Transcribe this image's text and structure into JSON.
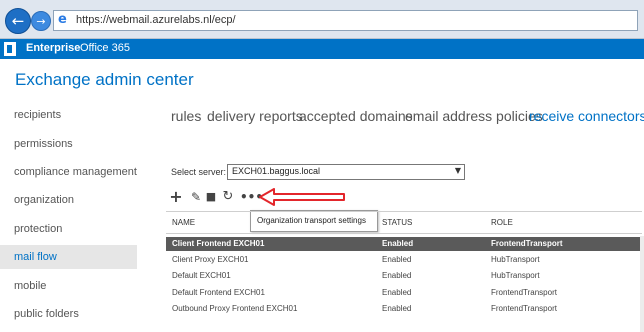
{
  "browser": {
    "url": "https://webmail.azurelabs.nl/ecp/",
    "back_icon": "back-arrow-icon",
    "forward_icon": "forward-arrow-icon"
  },
  "office_header": {
    "tabs": [
      "Enterprise",
      "Office 365"
    ],
    "logo_icon": "office-logo-icon"
  },
  "app": {
    "title": "Exchange admin center"
  },
  "sidebar": {
    "items": [
      {
        "label": "recipients"
      },
      {
        "label": "permissions"
      },
      {
        "label": "compliance management"
      },
      {
        "label": "organization"
      },
      {
        "label": "protection"
      },
      {
        "label": "mail flow",
        "selected": true
      },
      {
        "label": "mobile"
      },
      {
        "label": "public folders"
      }
    ]
  },
  "tabs": [
    {
      "label": "rules"
    },
    {
      "label": "delivery reports"
    },
    {
      "label": "accepted domains"
    },
    {
      "label": "email address policies"
    },
    {
      "label": "receive connectors",
      "active": true
    }
  ],
  "server": {
    "label": "Select server:",
    "value": "EXCH01.baggus.local"
  },
  "toolbar": {
    "icons": [
      "add-icon",
      "edit-icon",
      "delete-icon",
      "refresh-icon",
      "more-icon"
    ],
    "tooltip": "Organization transport settings"
  },
  "table": {
    "columns": [
      "NAME",
      "STATUS",
      "ROLE"
    ],
    "rows": [
      {
        "name": "Client Frontend EXCH01",
        "status": "Enabled",
        "role": "FrontendTransport",
        "selected": true
      },
      {
        "name": "Client Proxy EXCH01",
        "status": "Enabled",
        "role": "HubTransport"
      },
      {
        "name": "Default EXCH01",
        "status": "Enabled",
        "role": "HubTransport"
      },
      {
        "name": "Default Frontend EXCH01",
        "status": "Enabled",
        "role": "FrontendTransport"
      },
      {
        "name": "Outbound Proxy Frontend EXCH01",
        "status": "Enabled",
        "role": "FrontendTransport"
      }
    ]
  },
  "colors": {
    "accent": "#0072c6",
    "selected_row": "#5a5a5a",
    "annotation_arrow": "#e3262b"
  }
}
